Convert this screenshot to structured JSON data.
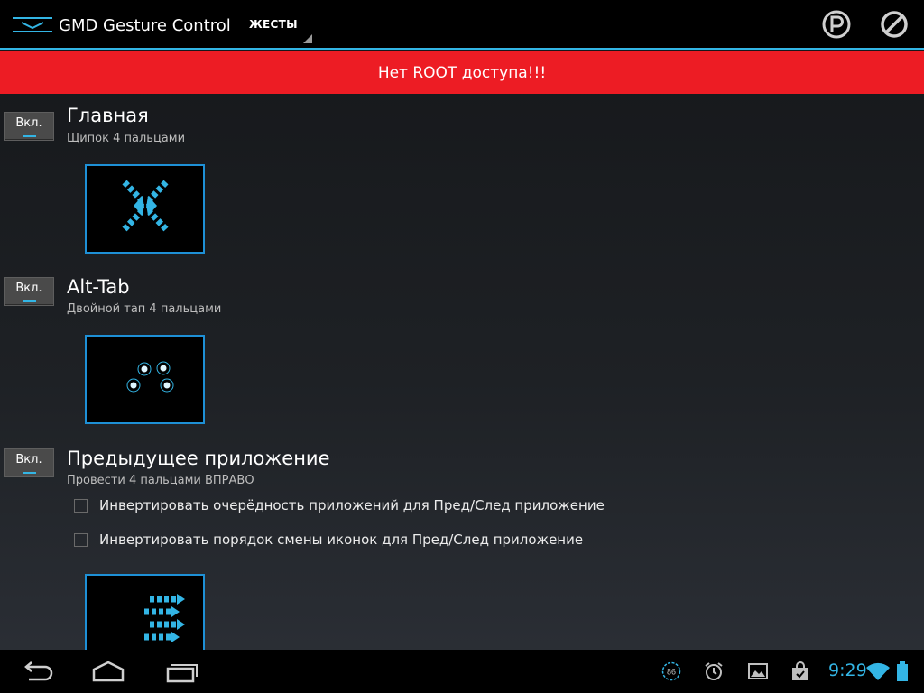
{
  "actionbar": {
    "app_title": "GMD Gesture Control",
    "spinner_label": "ЖЕСТЫ",
    "icons": [
      "app-menu-icon",
      "parking-p-icon",
      "block-icon"
    ],
    "accent": "#33b5e5"
  },
  "banner": {
    "text": "Нет ROOT доступа!!!",
    "color": "#ed1c24"
  },
  "gestures": [
    {
      "toggle": "Вкл.",
      "title": "Главная",
      "subtitle": "Щипок 4 пальцами",
      "preview_icon": "pinch-arrows-icon"
    },
    {
      "toggle": "Вкл.",
      "title": "Alt-Tab",
      "subtitle": "Двойной тап 4 пальцами",
      "preview_icon": "four-finger-tap-icon"
    },
    {
      "toggle": "Вкл.",
      "title": "Предыдущее приложение",
      "subtitle": "Провести 4 пальцами ВПРАВО",
      "options": [
        {
          "label": "Инвертировать очерёдность приложений для Пред/След приложение",
          "checked": false
        },
        {
          "label": "Инвертировать порядок смены иконок для Пред/След приложение",
          "checked": false
        }
      ],
      "preview_icon": "swipe-right-arrows-icon"
    }
  ],
  "sysbar": {
    "time": "9:29",
    "badge_count": "86",
    "nav_icons": [
      "back-icon",
      "home-icon",
      "recent-apps-icon"
    ],
    "notification_icons": [
      "counter-badge-icon",
      "alarm-clock-icon",
      "gallery-icon",
      "shopping-bag-icon"
    ],
    "status_icons": [
      "wifi-icon",
      "battery-icon"
    ]
  }
}
